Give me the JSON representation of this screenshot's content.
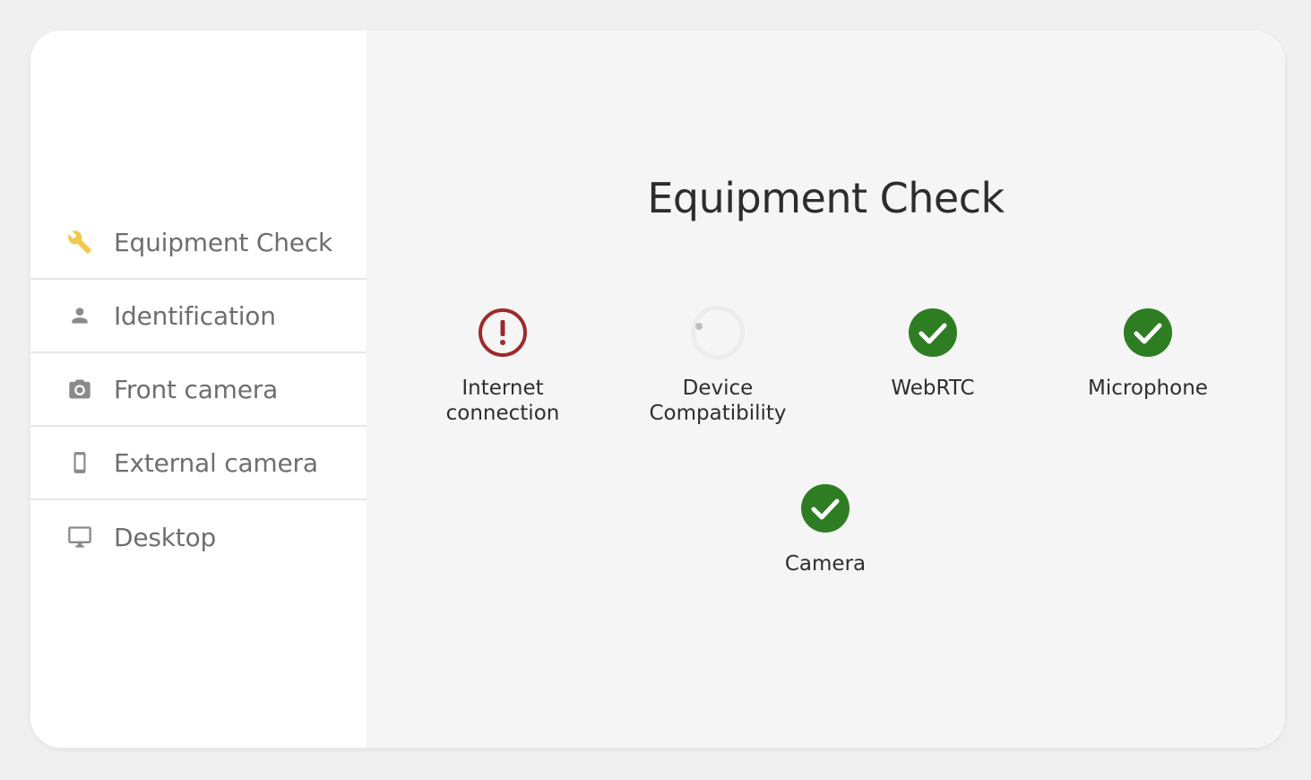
{
  "sidebar": {
    "items": [
      {
        "label": "Equipment Check",
        "icon": "wrench-icon",
        "color": "#f2c94c"
      },
      {
        "label": "Identification",
        "icon": "person-icon",
        "color": "#8a8a8a"
      },
      {
        "label": "Front camera",
        "icon": "camera-icon",
        "color": "#8a8a8a"
      },
      {
        "label": "External camera",
        "icon": "smartphone-icon",
        "color": "#8a8a8a"
      },
      {
        "label": "Desktop",
        "icon": "monitor-icon",
        "color": "#8a8a8a"
      }
    ]
  },
  "main": {
    "title": "Equipment Check",
    "checks": [
      {
        "label": "Internet connection",
        "status": "error",
        "icon": "error-icon"
      },
      {
        "label": "Device Compatibility",
        "status": "loading",
        "icon": "spinner-icon"
      },
      {
        "label": "WebRTC",
        "status": "success",
        "icon": "check-circle-icon"
      },
      {
        "label": "Microphone",
        "status": "success",
        "icon": "check-circle-icon"
      },
      {
        "label": "Camera",
        "status": "success",
        "icon": "check-circle-icon"
      }
    ]
  },
  "colors": {
    "success": "#2e7d23",
    "error": "#9e2a2b",
    "accent": "#f2c94c"
  }
}
